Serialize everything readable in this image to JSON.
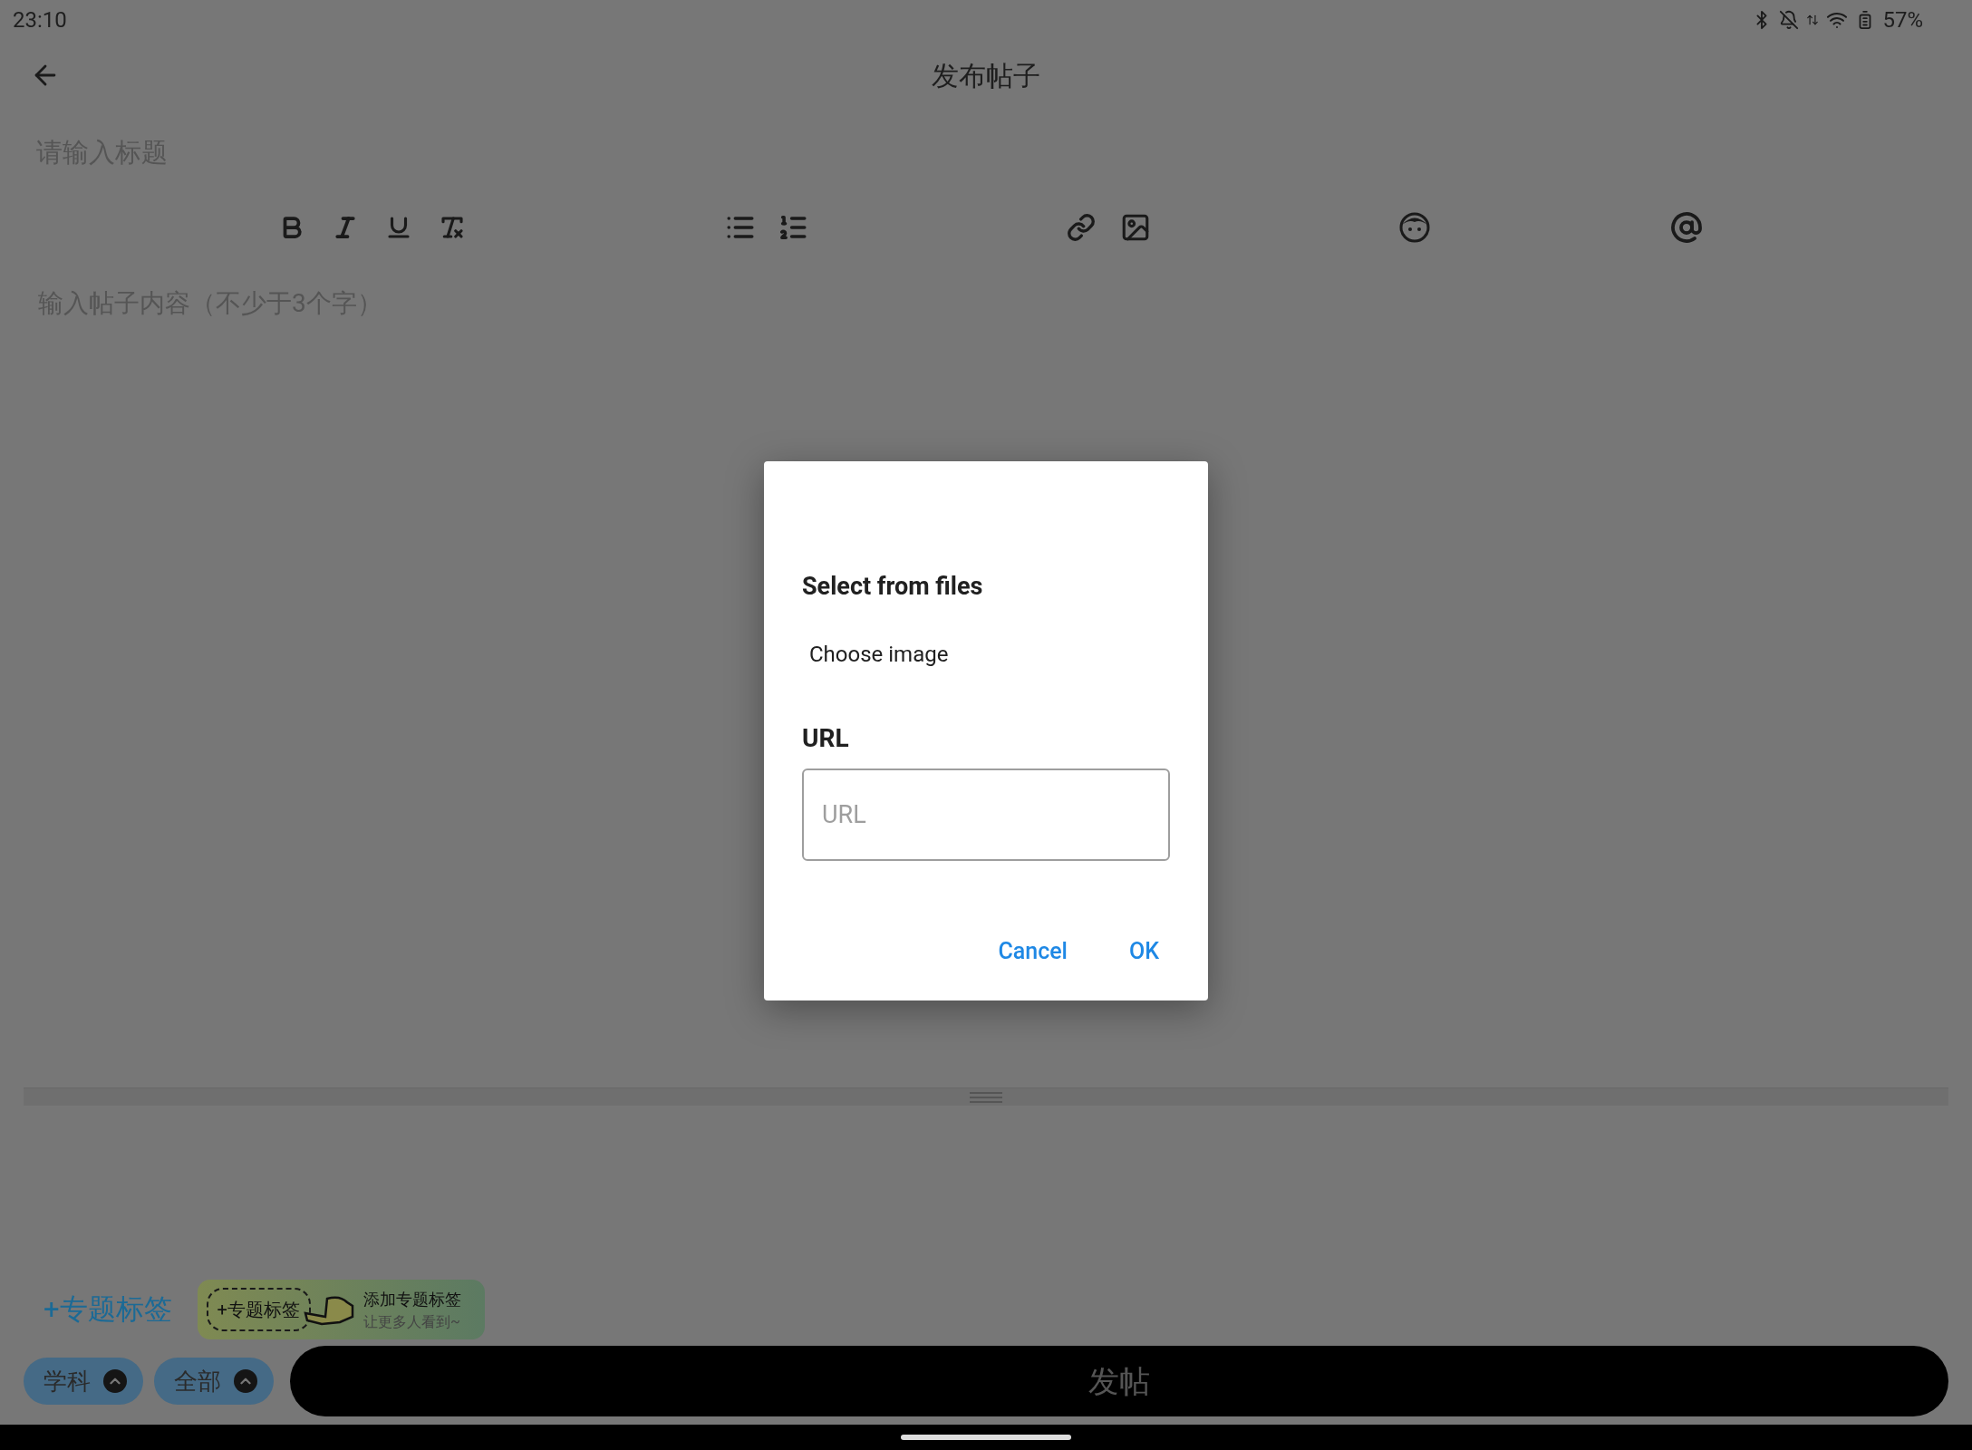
{
  "status_bar": {
    "time": "23:10",
    "battery": "57%"
  },
  "header": {
    "title": "发布帖子"
  },
  "title_field": {
    "placeholder": "请输入标题"
  },
  "content_field": {
    "placeholder": "输入帖子内容（不少于3个字）"
  },
  "dialog": {
    "title": "Select from files",
    "choose": "Choose image",
    "url_label": "URL",
    "url_field": {
      "placeholder": "URL"
    },
    "buttons": [
      "Cancel",
      "OK"
    ]
  },
  "topic_link": "+专题标签",
  "tip": {
    "chip": "+专题标签",
    "title": "添加专题标签",
    "subtitle": "让更多人看到~"
  },
  "filters": [
    "学科",
    "全部"
  ],
  "submit": "发帖"
}
